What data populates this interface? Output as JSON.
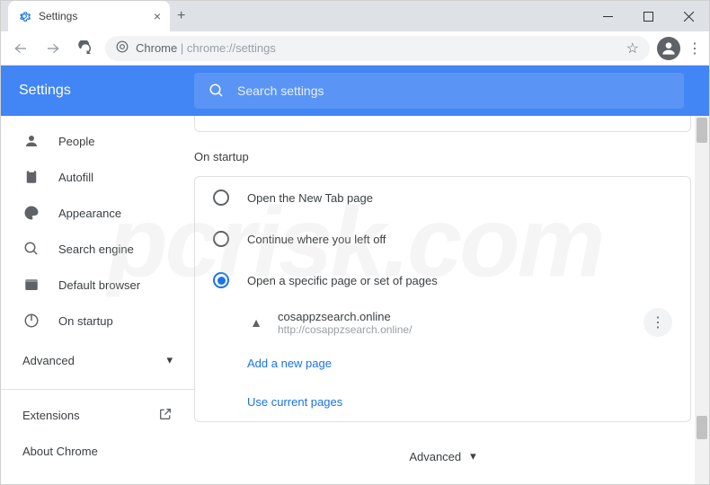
{
  "tab": {
    "title": "Settings"
  },
  "omnibox": {
    "label": "Chrome",
    "url": "chrome://settings"
  },
  "header": {
    "title": "Settings",
    "search_placeholder": "Search settings"
  },
  "sidebar": {
    "items": [
      {
        "label": "People"
      },
      {
        "label": "Autofill"
      },
      {
        "label": "Appearance"
      },
      {
        "label": "Search engine"
      },
      {
        "label": "Default browser"
      },
      {
        "label": "On startup"
      }
    ],
    "advanced": "Advanced",
    "extensions": "Extensions",
    "about": "About Chrome"
  },
  "main": {
    "section_title": "On startup",
    "radio1": "Open the New Tab page",
    "radio2": "Continue where you left off",
    "radio3": "Open a specific page or set of pages",
    "startup_page": {
      "name": "cosappzsearch.online",
      "url": "http://cosappzsearch.online/"
    },
    "add_page": "Add a new page",
    "use_current": "Use current pages",
    "advanced": "Advanced"
  },
  "watermark": "pcrisk.com"
}
